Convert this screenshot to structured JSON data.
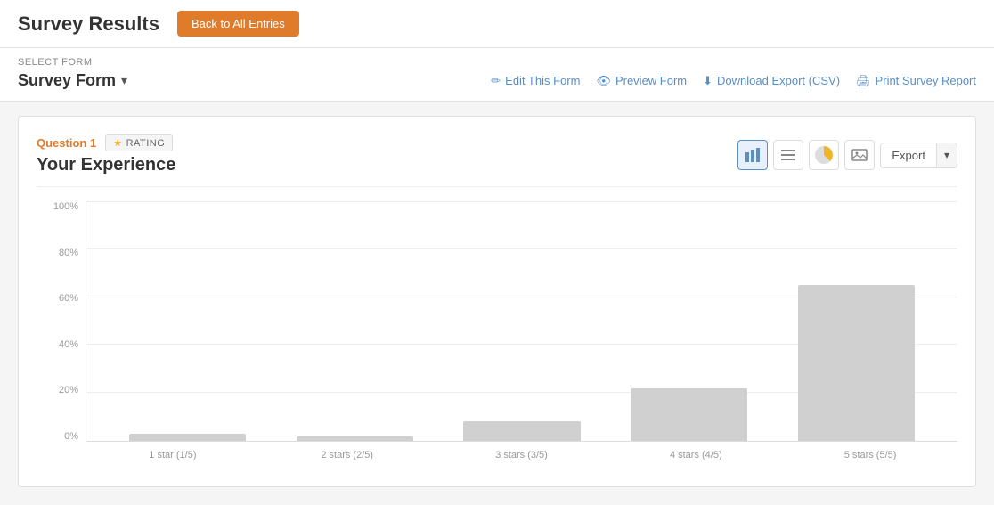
{
  "header": {
    "title": "Survey Results",
    "back_button": "Back to All Entries"
  },
  "subbar": {
    "select_form_label": "SELECT FORM",
    "form_name": "Survey Form",
    "actions": [
      {
        "id": "edit",
        "label": "Edit This Form",
        "icon": "✏"
      },
      {
        "id": "preview",
        "label": "Preview Form",
        "icon": "👁"
      },
      {
        "id": "export",
        "label": "Download Export (CSV)",
        "icon": "⬆"
      },
      {
        "id": "print",
        "label": "Print Survey Report",
        "icon": "🖨"
      }
    ]
  },
  "question": {
    "number": "Question 1",
    "type": "RATING",
    "title": "Your Experience"
  },
  "chart_controls": {
    "export_label": "Export"
  },
  "chart": {
    "y_labels": [
      "0%",
      "20%",
      "40%",
      "60%",
      "80%",
      "100%"
    ],
    "bars": [
      {
        "label": "1 star (1/5)",
        "value": 3
      },
      {
        "label": "2 stars (2/5)",
        "value": 2
      },
      {
        "label": "3 stars (3/5)",
        "value": 8
      },
      {
        "label": "4 stars (4/5)",
        "value": 22
      },
      {
        "label": "5 stars (5/5)",
        "value": 65
      }
    ]
  }
}
